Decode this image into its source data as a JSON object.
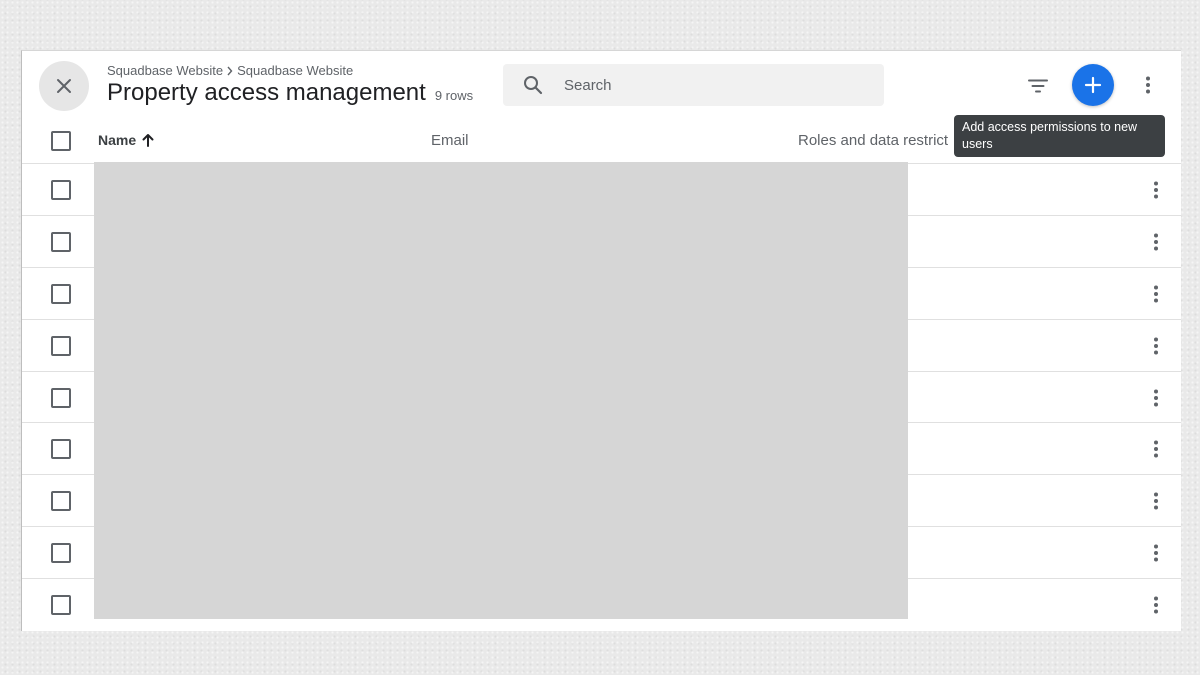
{
  "header": {
    "breadcrumb": [
      "Squadbase Website",
      "Squadbase Website"
    ],
    "title": "Property access management",
    "row_count": "9 rows"
  },
  "search": {
    "placeholder": "Search"
  },
  "tooltip": {
    "text": "Add access permissions to new users"
  },
  "table": {
    "columns": [
      {
        "label": "Name",
        "sort": "ascending"
      },
      {
        "label": "Email"
      },
      {
        "label": "Roles and data restrict"
      }
    ],
    "row_total": 9
  },
  "colors": {
    "accent": "#1a73e8",
    "tooltip_bg": "#3c4043",
    "redacted": "#d6d6d6"
  },
  "icons": {
    "close": "close-icon",
    "search": "search-icon",
    "filter": "filter-icon",
    "add": "plus-icon",
    "more": "more-vert-icon",
    "sort": "arrow-up-icon"
  }
}
